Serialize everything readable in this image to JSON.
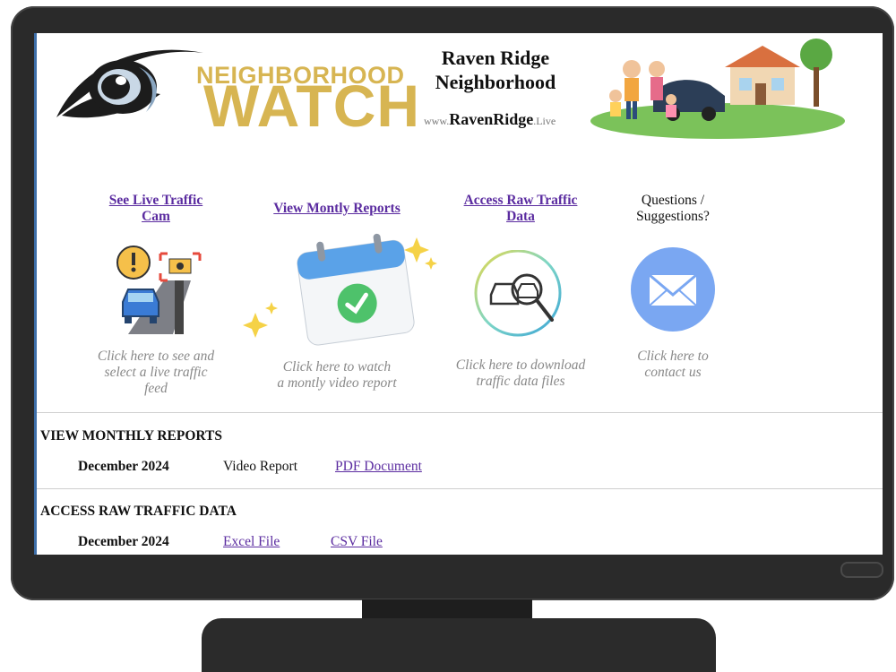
{
  "header": {
    "logo_word_top": "NEIGHBORHOOD",
    "logo_word_bottom": "WATCH",
    "title_line1": "Raven Ridge",
    "title_line2": "Neighborhood",
    "url_prefix": "www.",
    "url_domain": "RavenRidge",
    "url_suffix": ".Live"
  },
  "cards": [
    {
      "title_line1": "See Live Traffic",
      "title_line2": "Cam",
      "caption_lines": [
        "Click here to see and",
        "select a live traffic",
        "feed"
      ],
      "icon": "traffic-camera-icon"
    },
    {
      "title_line1": "View  Montly Reports",
      "caption_lines": [
        "Click here to watch",
        "a montly video report"
      ],
      "icon": "calendar-check-icon"
    },
    {
      "title_line1": "Access Raw Traffic",
      "title_line2": "Data",
      "caption_lines": [
        "Click here to download",
        "traffic data files"
      ],
      "icon": "car-search-icon"
    },
    {
      "title_line1": "Questions /",
      "title_line2": "Suggestions?",
      "caption_lines": [
        "Click here to",
        "contact us"
      ],
      "icon": "envelope-icon"
    }
  ],
  "reports": {
    "heading": "VIEW MONTHLY REPORTS",
    "rows": [
      {
        "month": "December 2024",
        "video": "Video Report",
        "pdf": "PDF Document"
      }
    ]
  },
  "raw_data": {
    "heading": "ACCESS RAW TRAFFIC DATA",
    "rows": [
      {
        "month": "December 2024",
        "excel": "Excel File",
        "csv": "CSV File"
      }
    ]
  },
  "colors": {
    "link": "#5b2ca0",
    "logo_gold": "#d7b552",
    "envelope_circle": "#7aa7f2"
  }
}
